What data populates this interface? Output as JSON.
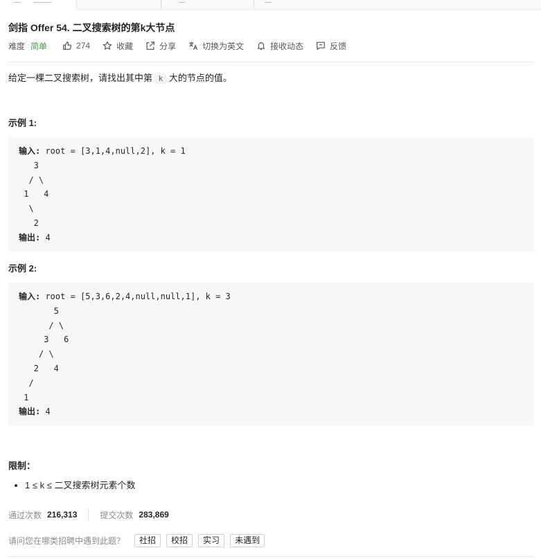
{
  "problem": {
    "title": "剑指 Offer 54. 二叉搜索树的第k大节点",
    "difficulty_label": "难度",
    "difficulty_value": "简单",
    "likes": "274",
    "favorite_label": "收藏",
    "share_label": "分享",
    "switch_lang_label": "切换为英文",
    "subscribe_label": "接收动态",
    "feedback_label": "反馈"
  },
  "description": {
    "before": "给定一棵二叉搜索树，请找出其中第",
    "code": "k",
    "after": "大的节点的值。"
  },
  "examples": [
    {
      "title": "示例 1:",
      "input_label": "输入:",
      "input_value": " root = [3,1,4,null,2], k = 1",
      "tree": "   3\n  / \\\n 1   4\n  \\\n   2",
      "output_label": "输出:",
      "output_value": " 4"
    },
    {
      "title": "示例 2:",
      "input_label": "输入:",
      "input_value": " root = [5,3,6,2,4,null,null,1], k = 3",
      "tree": "       5\n      / \\\n     3   6\n    / \\\n   2   4\n  /\n 1",
      "output_label": "输出:",
      "output_value": " 4"
    }
  ],
  "limits": {
    "title": "限制：",
    "items": [
      "1 ≤ k ≤ 二叉搜索树元素个数"
    ]
  },
  "stats": {
    "accepted_label": "通过次数",
    "accepted_value": "216,313",
    "submitted_label": "提交次数",
    "submitted_value": "283,869"
  },
  "survey": {
    "question": "请问您在哪类招聘中遇到此题？",
    "options": [
      "社招",
      "校招",
      "实习",
      "未遇到"
    ]
  },
  "colors": {
    "easy": "#43a047",
    "code_bg": "#f7f7f7",
    "divider": "#e8e8e8"
  },
  "icons": [
    "thumbs-up-icon",
    "star-icon",
    "share-icon",
    "translate-icon",
    "bell-icon",
    "feedback-icon"
  ]
}
